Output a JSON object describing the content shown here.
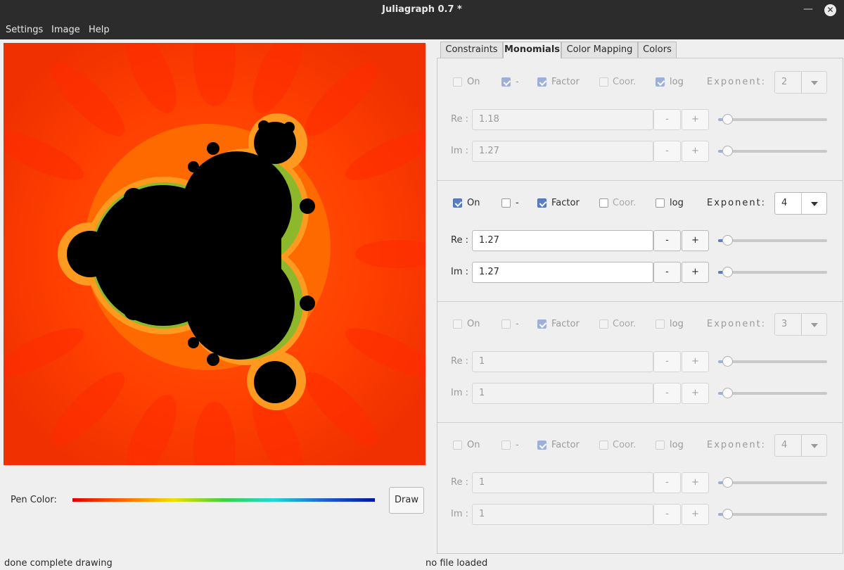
{
  "window": {
    "title": "Juliagraph 0.7 *",
    "minimize_glyph": "—",
    "close_glyph": "✕"
  },
  "menu": [
    "Settings",
    "Image",
    "Help"
  ],
  "pen": {
    "label": "Pen Color:",
    "draw_label": "Draw"
  },
  "status": {
    "left": "done complete drawing",
    "right": "no file loaded"
  },
  "tabs": [
    "Constraints",
    "Monomials",
    "Color Mapping",
    "Colors"
  ],
  "active_tab": "Monomials",
  "labels": {
    "on": "On",
    "minus": "-",
    "factor": "Factor",
    "coor": "Coor.",
    "log": "log",
    "exponent": "Exponent:",
    "re": "Re :",
    "im": "Im :",
    "btn_minus": "-",
    "btn_plus": "+"
  },
  "monomials": [
    {
      "enabled": false,
      "on": false,
      "minus": true,
      "factor": true,
      "coor": false,
      "log": true,
      "exponent": "2",
      "re": "1.18",
      "im": "1.27"
    },
    {
      "enabled": true,
      "on": true,
      "minus": false,
      "factor": true,
      "coor": false,
      "log": false,
      "exponent": "4",
      "re": "1.27",
      "im": "1.27"
    },
    {
      "enabled": false,
      "on": false,
      "minus": false,
      "factor": true,
      "coor": false,
      "log": false,
      "exponent": "3",
      "re": "1",
      "im": "1"
    },
    {
      "enabled": false,
      "on": false,
      "minus": false,
      "factor": true,
      "coor": false,
      "log": false,
      "exponent": "4",
      "re": "1",
      "im": "1"
    }
  ],
  "colors": {
    "fractal_background": "#ff3c00",
    "fractal_interior": "#000000",
    "accent": "#5a7ec4"
  },
  "icons": {
    "minimize": "minimize-icon",
    "close": "close-icon",
    "dropdown": "chevron-down-icon"
  }
}
